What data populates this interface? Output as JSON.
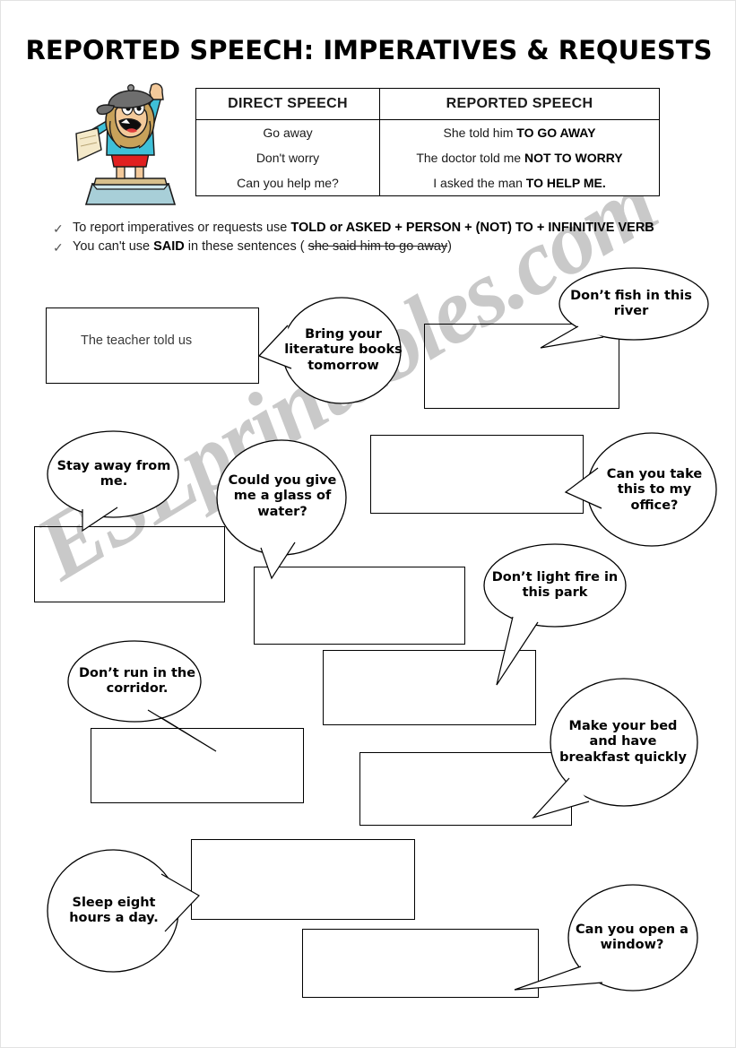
{
  "page": {
    "title": "REPORTED SPEECH: IMPERATIVES & REQUESTS",
    "watermark": "ESLprintables.com"
  },
  "table": {
    "headers": [
      "DIRECT SPEECH",
      "REPORTED SPEECH"
    ],
    "rows": [
      {
        "direct": "Go away",
        "reported_plain": "She told him ",
        "reported_bold": "TO GO AWAY"
      },
      {
        "direct": "Don't worry",
        "reported_plain": "The doctor told me ",
        "reported_bold": "NOT TO WORRY"
      },
      {
        "direct": "Can you help me?",
        "reported_plain": "I asked the man ",
        "reported_bold": "TO HELP ME."
      }
    ]
  },
  "bullets": [
    {
      "marker": "✓",
      "plain1": "To report imperatives or requests use ",
      "bold1": "TOLD or ASKED + PERSON + (NOT) TO + INFINITIVE VERB",
      "plain2": "",
      "struck": "",
      "plain3": ""
    },
    {
      "marker": "✓",
      "plain1": "You can't use ",
      "bold1": "SAID",
      "plain2": " in these sentences ( ",
      "struck": "she said him to go away",
      "plain3": ")"
    }
  ],
  "exercises": [
    {
      "id": "ex1",
      "box_text": "The teacher told us",
      "bubble_text": "Bring your literature books tomorrow"
    },
    {
      "id": "ex2",
      "box_text": "",
      "bubble_text": "Don’t fish in this river"
    },
    {
      "id": "ex3",
      "box_text": "",
      "bubble_text": "Stay away from me."
    },
    {
      "id": "ex4",
      "box_text": "",
      "bubble_text": "Could you give me a glass of water?"
    },
    {
      "id": "ex5",
      "box_text": "",
      "bubble_text": "Can you take this to my office?"
    },
    {
      "id": "ex6",
      "box_text": "",
      "bubble_text": "Don’t light fire in this park"
    },
    {
      "id": "ex7",
      "box_text": "",
      "bubble_text": "Don’t run in the corridor."
    },
    {
      "id": "ex8",
      "box_text": "",
      "bubble_text": "Make your bed and have breakfast quickly"
    },
    {
      "id": "ex9",
      "box_text": "",
      "bubble_text": "Sleep eight hours a day."
    },
    {
      "id": "ex10",
      "box_text": "",
      "bubble_text": "Can you open a window?"
    }
  ],
  "colors": {
    "ink": "#000000",
    "watermark": "#c9c9c9",
    "cartoon_shirt": "#3fc0d8",
    "cartoon_hair": "#c8a15a",
    "cartoon_cap": "#6e6e6e",
    "cartoon_shorts": "#e02020",
    "cartoon_box": "#a8cfd8"
  }
}
